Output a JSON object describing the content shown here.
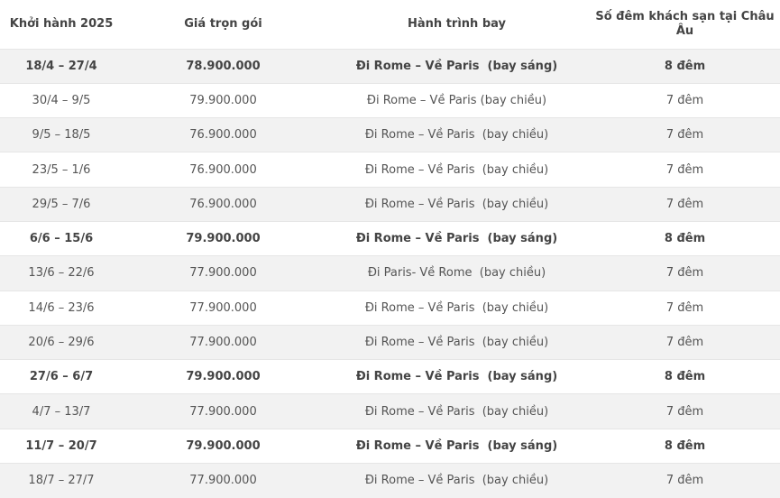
{
  "header": {
    "col1": "Khởi hành 2025",
    "col2": "Giá trọn gói",
    "col3": "Hành trình bay",
    "col4": "Số đêm khách sạn tại Châu Âu"
  },
  "rows": [
    {
      "date": "18/4 – 27/4",
      "price": "78.900.000",
      "route": "Đi Rome – Về Paris  (bay sáng)",
      "nights": "8 đêm",
      "bold": true
    },
    {
      "date": "30/4 – 9/5",
      "price": "79.900.000",
      "route": "Đi Rome – Về Paris (bay chiều)",
      "nights": "7 đêm",
      "bold": false
    },
    {
      "date": "9/5 – 18/5",
      "price": "76.900.000",
      "route": "Đi Rome – Về Paris  (bay chiều)",
      "nights": "7 đêm",
      "bold": false
    },
    {
      "date": "23/5 – 1/6",
      "price": "76.900.000",
      "route": "Đi Rome – Về Paris  (bay chiều)",
      "nights": "7 đêm",
      "bold": false
    },
    {
      "date": "29/5 – 7/6",
      "price": "76.900.000",
      "route": "Đi Rome – Về Paris  (bay chiều)",
      "nights": "7 đêm",
      "bold": false
    },
    {
      "date": "6/6 – 15/6",
      "price": "79.900.000",
      "route": "Đi Rome – Về Paris  (bay sáng)",
      "nights": "8 đêm",
      "bold": true
    },
    {
      "date": "13/6 – 22/6",
      "price": "77.900.000",
      "route": "Đi Paris- Về Rome  (bay chiều)",
      "nights": "7 đêm",
      "bold": false
    },
    {
      "date": "14/6 – 23/6",
      "price": "77.900.000",
      "route": "Đi Rome – Về Paris  (bay chiều)",
      "nights": "7 đêm",
      "bold": false
    },
    {
      "date": "20/6 – 29/6",
      "price": "77.900.000",
      "route": "Đi Rome – Về Paris  (bay chiều)",
      "nights": "7 đêm",
      "bold": false
    },
    {
      "date": "27/6 – 6/7",
      "price": "79.900.000",
      "route": "Đi Rome – Về Paris  (bay sáng)",
      "nights": "8 đêm",
      "bold": true
    },
    {
      "date": "4/7 – 13/7",
      "price": "77.900.000",
      "route": "Đi Rome – Về Paris  (bay chiều)",
      "nights": "7 đêm",
      "bold": false
    },
    {
      "date": "11/7 – 20/7",
      "price": "79.900.000",
      "route": "Đi Rome – Về Paris  (bay sáng)",
      "nights": "8 đêm",
      "bold": true
    },
    {
      "date": "18/7 – 27/7",
      "price": "77.900.000",
      "route": "Đi Rome – Về Paris  (bay chiều)",
      "nights": "7 đêm",
      "bold": false
    }
  ]
}
